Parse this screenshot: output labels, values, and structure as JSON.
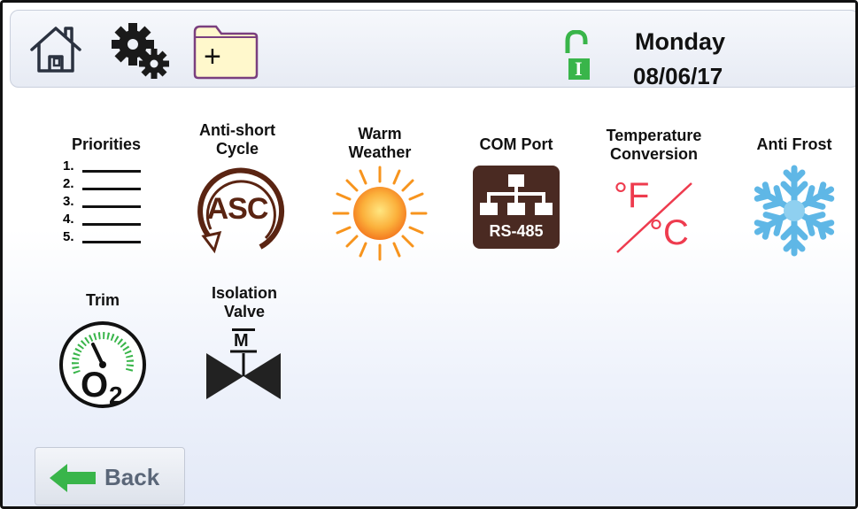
{
  "header": {
    "day": "Monday",
    "date": "08/06/17",
    "lock_badge": "I",
    "folder_plus": "+"
  },
  "tiles": [
    {
      "label": "Priorities",
      "list_numbers": [
        "1.",
        "2.",
        "3.",
        "4.",
        "5."
      ]
    },
    {
      "label": "Anti-short\nCycle",
      "icon_text": "ASC"
    },
    {
      "label": "Warm\nWeather"
    },
    {
      "label": "COM Port",
      "icon_text": "RS-485"
    },
    {
      "label": "Temperature\nConversion",
      "icon_f": "°F",
      "icon_c": "°C"
    },
    {
      "label": "Anti Frost"
    },
    {
      "label": "Trim",
      "icon_text": "O",
      "icon_sub": "2"
    },
    {
      "label": "Isolation\nValve",
      "icon_text": "M"
    }
  ],
  "back": {
    "label": "Back"
  },
  "colors": {
    "green": "#39b54a",
    "asc_brown": "#5a2412",
    "sun_orange": "#f7941d",
    "snow_blue": "#5fb7e6",
    "temp_red": "#ee3b4e",
    "port_dark": "#4a2a22"
  }
}
